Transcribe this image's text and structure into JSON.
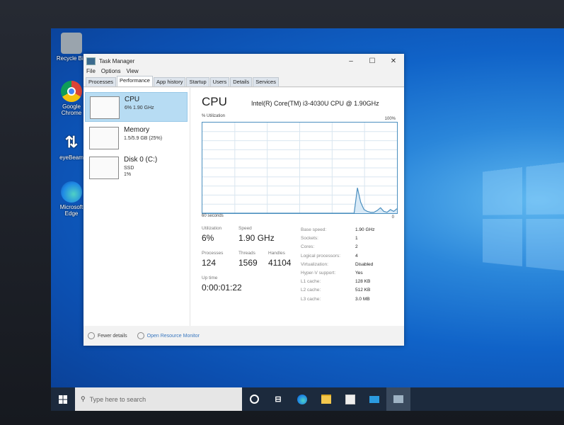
{
  "desktop": {
    "icons": [
      {
        "label": "Recycle Bin",
        "icon": "recycle-bin-icon"
      },
      {
        "label": "Google Chrome",
        "icon": "chrome-icon"
      },
      {
        "label": "eyeBeam",
        "icon": "eyebeam-icon"
      },
      {
        "label": "Microsoft Edge",
        "icon": "edge-icon"
      }
    ]
  },
  "window": {
    "title": "Task Manager",
    "menu": [
      "File",
      "Options",
      "View"
    ],
    "tabs": [
      "Processes",
      "Performance",
      "App history",
      "Startup",
      "Users",
      "Details",
      "Services"
    ],
    "active_tab": "Performance"
  },
  "sidebar": {
    "items": [
      {
        "label": "CPU",
        "sub1": "6%  1.90 GHz",
        "sub2": ""
      },
      {
        "label": "Memory",
        "sub1": "1.5/5.9 GB (25%)",
        "sub2": ""
      },
      {
        "label": "Disk 0 (C:)",
        "sub1": "SSD",
        "sub2": "1%"
      }
    ]
  },
  "cpu": {
    "heading": "CPU",
    "model": "Intel(R) Core(TM) i3-4030U CPU @ 1.90GHz",
    "graph_label": "% Utilization",
    "graph_max": "100%",
    "graph_time": "60 seconds",
    "graph_min": "0",
    "utilization_history": [
      0,
      0,
      0,
      0,
      0,
      0,
      0,
      0,
      0,
      0,
      0,
      0,
      0,
      0,
      0,
      0,
      0,
      0,
      0,
      0,
      0,
      0,
      0,
      0,
      0,
      0,
      0,
      0,
      0,
      0,
      0,
      0,
      0,
      0,
      0,
      0,
      0,
      0,
      0,
      0,
      0,
      0,
      0,
      0,
      0,
      0,
      0,
      28,
      12,
      4,
      2,
      1,
      1,
      3,
      6,
      2,
      1,
      4,
      2,
      5
    ],
    "stats": {
      "utilization_label": "Utilization",
      "utilization": "6%",
      "speed_label": "Speed",
      "speed": "1.90 GHz",
      "processes_label": "Processes",
      "processes": "124",
      "threads_label": "Threads",
      "threads": "1569",
      "handles_label": "Handles",
      "handles": "41104",
      "uptime_label": "Up time",
      "uptime": "0:00:01:22"
    },
    "details": [
      {
        "k": "Base speed:",
        "v": "1.90 GHz"
      },
      {
        "k": "Sockets:",
        "v": "1"
      },
      {
        "k": "Cores:",
        "v": "2"
      },
      {
        "k": "Logical processors:",
        "v": "4"
      },
      {
        "k": "Virtualization:",
        "v": "Disabled"
      },
      {
        "k": "Hyper-V support:",
        "v": "Yes"
      },
      {
        "k": "L1 cache:",
        "v": "128 KB"
      },
      {
        "k": "L2 cache:",
        "v": "512 KB"
      },
      {
        "k": "L3 cache:",
        "v": "3.0 MB"
      }
    ]
  },
  "footer": {
    "fewer_details": "Fewer details",
    "resource_monitor": "Open Resource Monitor"
  },
  "taskbar": {
    "search_placeholder": "Type here to search"
  },
  "colors": {
    "graph_line": "#4b8fbf",
    "graph_fill": "#d9eaf7",
    "selection": "#b7dcf3"
  }
}
